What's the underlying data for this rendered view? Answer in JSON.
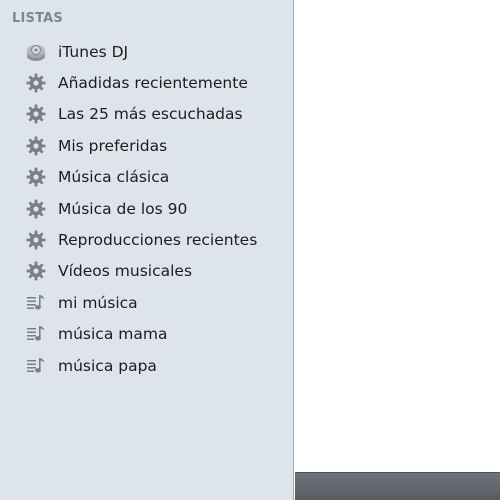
{
  "sidebar": {
    "header": "LISTAS",
    "items": [
      {
        "label": "iTunes DJ",
        "icon": "dj-icon"
      },
      {
        "label": "Añadidas recientemente",
        "icon": "smart-playlist-gear-icon"
      },
      {
        "label": "Las 25 más escuchadas",
        "icon": "smart-playlist-gear-icon"
      },
      {
        "label": "Mis preferidas",
        "icon": "smart-playlist-gear-icon"
      },
      {
        "label": "Música clásica",
        "icon": "smart-playlist-gear-icon"
      },
      {
        "label": "Música de los 90",
        "icon": "smart-playlist-gear-icon"
      },
      {
        "label": "Reproducciones recientes",
        "icon": "smart-playlist-gear-icon"
      },
      {
        "label": "Vídeos musicales",
        "icon": "smart-playlist-gear-icon"
      },
      {
        "label": "mi música",
        "icon": "playlist-icon"
      },
      {
        "label": "música mama",
        "icon": "playlist-icon"
      },
      {
        "label": "música papa",
        "icon": "playlist-icon"
      }
    ]
  },
  "colors": {
    "sidebar_bg": "#dee4eb",
    "header_text": "#7e8791",
    "icon_gray": "#7b8087",
    "bottom_bar": "#62666c"
  }
}
